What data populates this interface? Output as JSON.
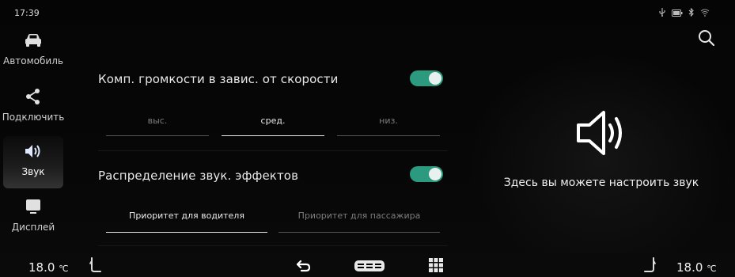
{
  "status": {
    "time": "17:39",
    "icons": [
      "usb-icon",
      "battery-icon",
      "bluetooth-icon",
      "wifi-icon"
    ]
  },
  "sidebar": {
    "items": [
      {
        "label": "Автомобиль",
        "icon": "car-icon",
        "active": false
      },
      {
        "label": "Подключить",
        "icon": "share-icon",
        "active": false
      },
      {
        "label": "Звук",
        "icon": "speaker-icon",
        "active": true
      },
      {
        "label": "Дисплей",
        "icon": "display-icon",
        "active": false
      }
    ]
  },
  "settings": {
    "speed_volume": {
      "title": "Комп. громкости в завис. от скорости",
      "enabled": true,
      "options": [
        "выс.",
        "сред.",
        "низ."
      ],
      "selected": "сред."
    },
    "sound_effects": {
      "title": "Распределение звук. эффектов",
      "enabled": true,
      "options": [
        "Приоритет для водителя",
        "Приоритет для пассажира"
      ],
      "selected": "Приоритет для водителя"
    }
  },
  "info": {
    "icon": "speaker-icon",
    "text": "Здесь вы можете настроить звук"
  },
  "bottom_bar": {
    "left_temp": "18.0",
    "right_temp": "18.0",
    "unit": "℃"
  },
  "colors": {
    "accent": "#2b9a7f",
    "background": "#050505"
  }
}
